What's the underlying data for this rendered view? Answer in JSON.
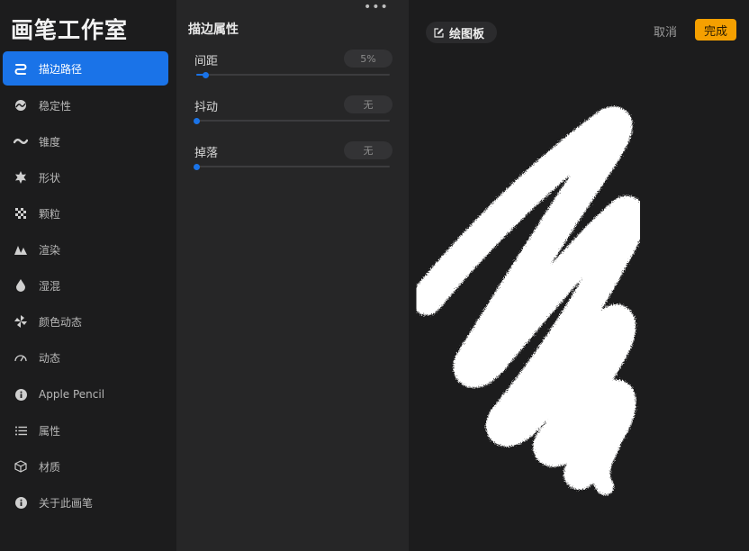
{
  "app": {
    "title": "画笔工作室"
  },
  "sidebar": {
    "items": [
      {
        "label": "描边路径",
        "icon": "stroke-path-icon",
        "active": true
      },
      {
        "label": "稳定性",
        "icon": "stabilization-icon",
        "active": false
      },
      {
        "label": "锥度",
        "icon": "taper-icon",
        "active": false
      },
      {
        "label": "形状",
        "icon": "shape-icon",
        "active": false
      },
      {
        "label": "颗粒",
        "icon": "grain-icon",
        "active": false
      },
      {
        "label": "渲染",
        "icon": "rendering-icon",
        "active": false
      },
      {
        "label": "湿混",
        "icon": "wet-mix-icon",
        "active": false
      },
      {
        "label": "颜色动态",
        "icon": "color-dynamics-icon",
        "active": false
      },
      {
        "label": "动态",
        "icon": "dynamics-icon",
        "active": false
      },
      {
        "label": "Apple Pencil",
        "icon": "apple-pencil-icon",
        "active": false
      },
      {
        "label": "属性",
        "icon": "properties-icon",
        "active": false
      },
      {
        "label": "材质",
        "icon": "material-icon",
        "active": false
      },
      {
        "label": "关于此画笔",
        "icon": "about-icon",
        "active": false
      }
    ]
  },
  "panel": {
    "title": "描边属性",
    "more": "•••",
    "sliders": [
      {
        "label": "间距",
        "value": "5%",
        "level": 0.05
      },
      {
        "label": "抖动",
        "value": "无",
        "level": 0
      },
      {
        "label": "掉落",
        "value": "无",
        "level": 0
      }
    ]
  },
  "pad": {
    "button_label": "绘图板",
    "button_icon": "edit-icon",
    "cancel_label": "取消",
    "done_label": "完成"
  },
  "colors": {
    "accent": "#1a73e8",
    "done": "#f5a000",
    "stroke": "#ffffff"
  }
}
